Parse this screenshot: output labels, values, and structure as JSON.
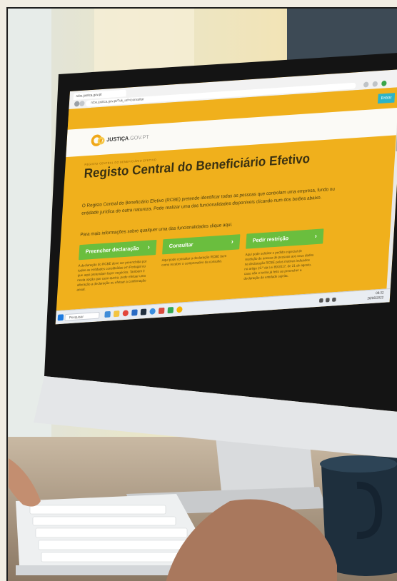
{
  "browser": {
    "tab_title": "rcbe.justica.gov.pt",
    "url": "rcbe.justica.gov.pt/?ok_url=/consultar",
    "login_button": "Entrar"
  },
  "site": {
    "logo_brand": "JUSTIÇA",
    "logo_suffix": ".GOV.PT",
    "breadcrumb": "REGISTO CENTRAL DO BENEFICIÁRIO EFETIVO",
    "heading": "Registo Central do Beneficiário Efetivo",
    "intro": "O Registo Central do Beneficiário Efetivo (RCBE) pretende identificar todas as pessoas que controlam uma empresa, fundo ou entidade jurídica de outra natureza. Pode realizar uma das funcionalidades disponíveis clicando num dos botões abaixo.",
    "more_info": "Para mais informações sobre qualquer uma das funcionalidades clique aqui.",
    "actions": [
      {
        "label": "Preencher declaração",
        "chevron": "›",
        "description": "A declaração do RCBE deve ser preenchida por todas as entidades constituídas em Portugal ou que aqui pretendam fazer negócios. Também é nesta opção que caso queira, pode efetuar uma alteração a declaração ou efetuar a confirmação anual."
      },
      {
        "label": "Consultar",
        "chevron": "›",
        "description": "Aqui pode consultar a declaração RCBE bem como receber o comprovativo da consulta."
      },
      {
        "label": "Pedir restrição",
        "chevron": "›",
        "description": "Aqui pode solicitar o pedido especial de restrição de acesso de pessoas aos seus dados na declaração RCBE pelos motivos indicados no artigo 22.º da Lei 89/2017, de 21 de agosto, caso não o tenha já feito ao preencher a declaração da entidade sujeita."
      }
    ]
  },
  "taskbar": {
    "search_placeholder": "Pesquisar",
    "time": "09:32",
    "date": "26/06/2022"
  },
  "colors": {
    "site_yellow": "#f0b01c",
    "button_green": "#6abe3e",
    "login_teal": "#2bb4c8"
  },
  "icons": [
    "windows-start-icon",
    "search-icon",
    "edge-icon",
    "folder-icon",
    "chrome-icon",
    "mail-icon",
    "store-icon",
    "wifi-icon",
    "speaker-icon",
    "battery-icon"
  ]
}
